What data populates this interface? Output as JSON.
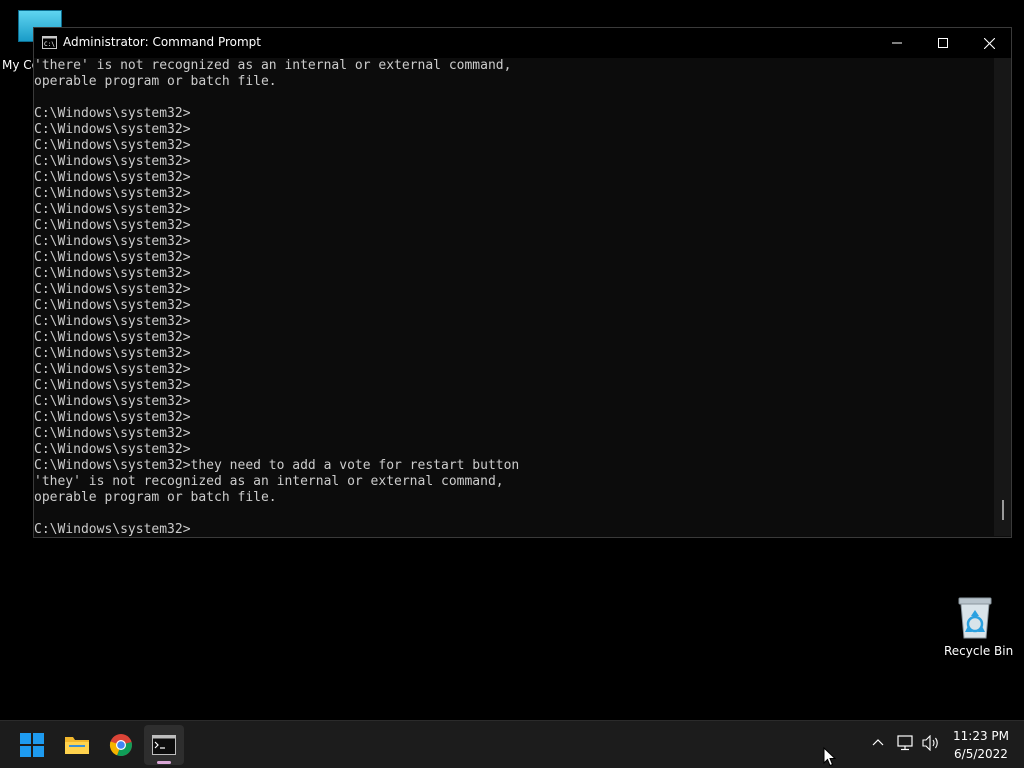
{
  "desktop": {
    "icons": [
      {
        "name": "my-computer",
        "label": "My Co"
      },
      {
        "name": "recycle-bin",
        "label": "Recycle Bin"
      }
    ]
  },
  "window": {
    "title": "Administrator: Command Prompt",
    "icon": "cmd-icon",
    "controls": {
      "minimize": "minimize-icon",
      "maximize": "maximize-icon",
      "close": "close-icon"
    }
  },
  "console": {
    "lines": [
      "'there' is not recognized as an internal or external command,",
      "operable program or batch file.",
      "",
      "C:\\Windows\\system32>",
      "C:\\Windows\\system32>",
      "C:\\Windows\\system32>",
      "C:\\Windows\\system32>",
      "C:\\Windows\\system32>",
      "C:\\Windows\\system32>",
      "C:\\Windows\\system32>",
      "C:\\Windows\\system32>",
      "C:\\Windows\\system32>",
      "C:\\Windows\\system32>",
      "C:\\Windows\\system32>",
      "C:\\Windows\\system32>",
      "C:\\Windows\\system32>",
      "C:\\Windows\\system32>",
      "C:\\Windows\\system32>",
      "C:\\Windows\\system32>",
      "C:\\Windows\\system32>",
      "C:\\Windows\\system32>",
      "C:\\Windows\\system32>",
      "C:\\Windows\\system32>",
      "C:\\Windows\\system32>",
      "C:\\Windows\\system32>",
      "C:\\Windows\\system32>they need to add a vote for restart button",
      "'they' is not recognized as an internal or external command,",
      "operable program or batch file.",
      "",
      "C:\\Windows\\system32>"
    ],
    "text_color": "#cccccc",
    "background": "#0c0c0c"
  },
  "taskbar": {
    "apps": [
      {
        "name": "start",
        "icon": "windows-logo-icon"
      },
      {
        "name": "file-explorer",
        "icon": "folder-icon"
      },
      {
        "name": "chrome",
        "icon": "chrome-icon"
      },
      {
        "name": "command-prompt",
        "icon": "cmd-icon",
        "active": true
      }
    ],
    "tray": {
      "icons": [
        "chevron-up-icon",
        "network-icon",
        "volume-icon"
      ],
      "time": "11:23 PM",
      "date": "6/5/2022"
    }
  }
}
